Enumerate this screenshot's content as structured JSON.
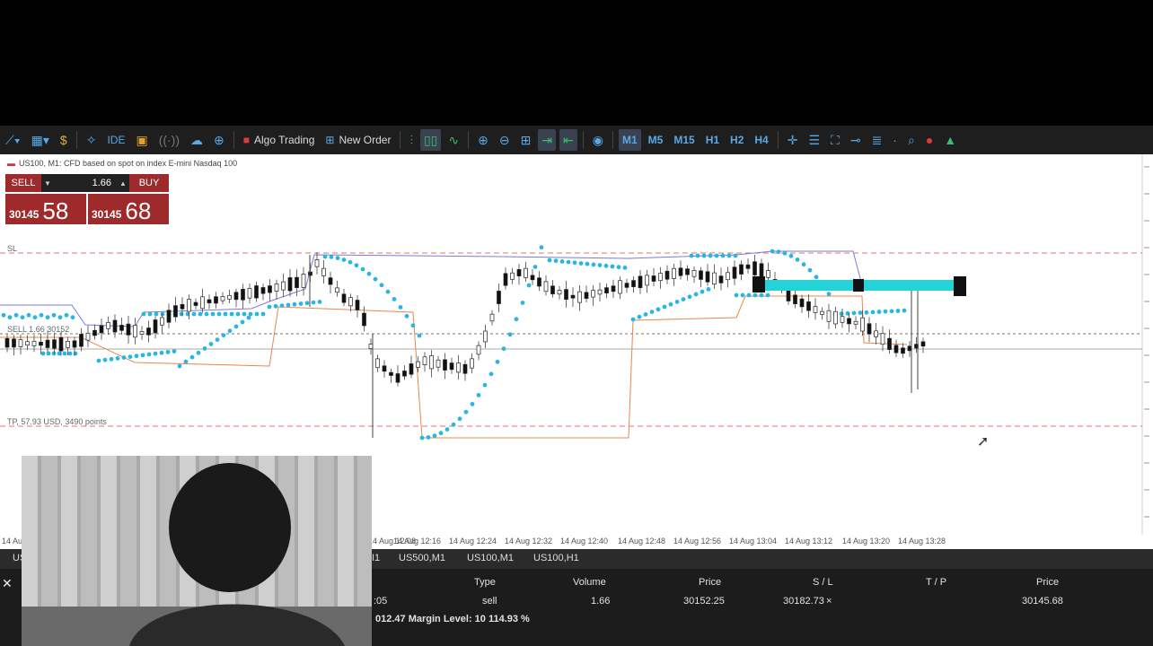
{
  "toolbar": {
    "algo_label": "Algo Trading",
    "order_label": "New Order",
    "ide_label": "IDE",
    "timeframes": [
      "M1",
      "M5",
      "M15",
      "H1",
      "H2",
      "H4"
    ]
  },
  "chart": {
    "title": "US100, M1:  CFD based on spot on index E-mini Nasdaq 100",
    "sell_label": "SELL",
    "buy_label": "BUY",
    "lot": "1.66",
    "bid_small": "30145",
    "bid_big": "58",
    "ask_small": "30145",
    "ask_big": "68",
    "sl_label": "SL",
    "sell_line_label": "SELL 1.66 30152",
    "tp_label": "TP, 57.93 USD, 3490 points",
    "time_labels": [
      "14 Au",
      "14 Aug 12:08",
      "14 Aug 12:16",
      "14 Aug 12:24",
      "14 Aug 12:32",
      "14 Aug 12:40",
      "14 Aug 12:48",
      "14 Aug 12:56",
      "14 Aug 13:04",
      "14 Aug 13:12",
      "14 Aug 13:20",
      "14 Aug 13:28"
    ]
  },
  "tabs": [
    "US",
    "I1",
    "US500,M1",
    "US100,M1",
    "US100,H1"
  ],
  "positions": {
    "headers": {
      "type": "Type",
      "volume": "Volume",
      "price": "Price",
      "sl": "S / L",
      "tp": "T / P",
      "cur_price": "Price"
    },
    "row": {
      "partial": ":05",
      "type": "sell",
      "volume": "1.66",
      "price": "30152.25",
      "sl": "30182.73",
      "cur_price": "30145.68"
    },
    "margin_text": "012.47  Margin Level: 10 114.93 %"
  },
  "colors": {
    "sell": "#9e2a2b",
    "sar": "#2ab6e0",
    "band": "#23d3d8"
  }
}
